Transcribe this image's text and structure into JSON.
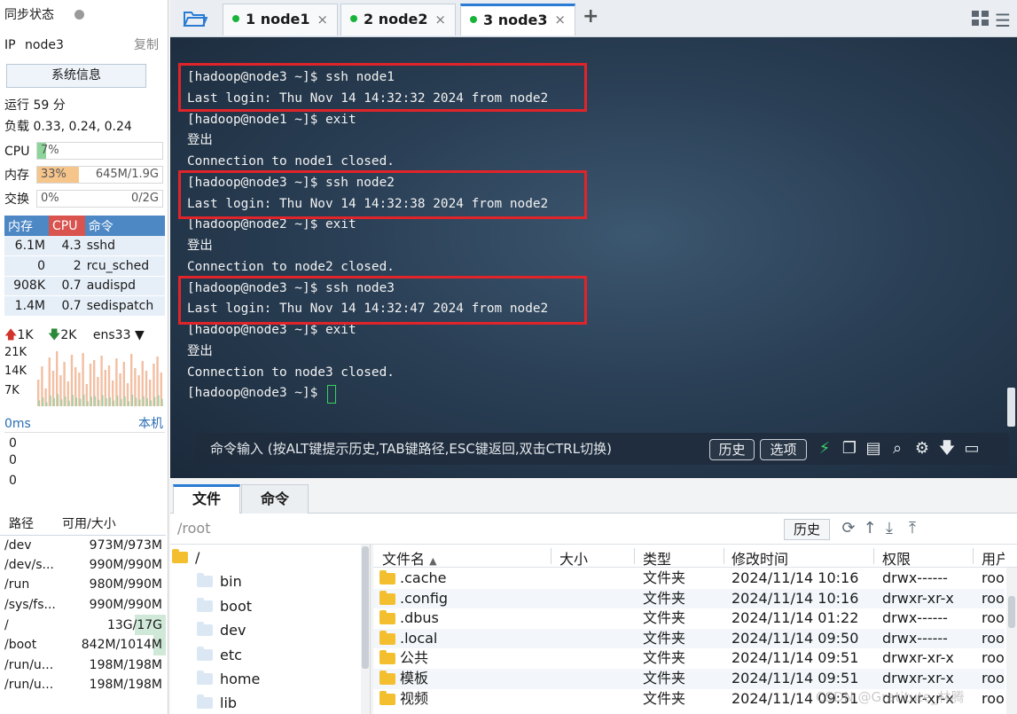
{
  "sidebar": {
    "sync_label": "同步状态",
    "ip_label": "IP",
    "ip_value": "node3",
    "copy_label": "复制",
    "sysinfo_button": "系统信息",
    "uptime": "运行 59 分",
    "load": "负载 0.33, 0.24, 0.24",
    "cpu": {
      "label": "CPU",
      "percent_text": "7%",
      "fraction": 0.07,
      "color": "#8dd49b"
    },
    "mem": {
      "label": "内存",
      "percent_text": "33%",
      "usage": "645M/1.9G",
      "fraction": 0.33,
      "color": "#f5c58c"
    },
    "swap": {
      "label": "交换",
      "percent_text": "0%",
      "usage": "0/2G",
      "fraction": 0.0
    },
    "proc_headers": [
      "内存",
      "CPU",
      "命令"
    ],
    "processes": [
      {
        "mem": "6.1M",
        "cpu": "4.3",
        "cmd": "sshd"
      },
      {
        "mem": "0",
        "cpu": "2",
        "cmd": "rcu_sched"
      },
      {
        "mem": "908K",
        "cpu": "0.7",
        "cmd": "audispd"
      },
      {
        "mem": "1.4M",
        "cpu": "0.7",
        "cmd": "sedispatch"
      }
    ],
    "net": {
      "up": "1K",
      "down": "2K",
      "iface": "ens33",
      "ticks": [
        "21K",
        "14K",
        "7K"
      ]
    },
    "latency": {
      "label": "0ms",
      "host": "本机",
      "values": [
        "0",
        "0",
        "0"
      ]
    },
    "disk_headers": [
      "路径",
      "可用/大小"
    ],
    "disks": [
      {
        "path": "/dev",
        "size": "973M/973M"
      },
      {
        "path": "/dev/s...",
        "size": "990M/990M"
      },
      {
        "path": "/run",
        "size": "980M/990M"
      },
      {
        "path": "/sys/fs...",
        "size": "990M/990M"
      },
      {
        "path": "/",
        "size": "13G/17G"
      },
      {
        "path": "/boot",
        "size": "842M/1014M"
      },
      {
        "path": "/run/u...",
        "size": "198M/198M"
      },
      {
        "path": "/run/u...",
        "size": "198M/198M"
      }
    ]
  },
  "tabs": [
    {
      "label": "1  node1",
      "close": "×"
    },
    {
      "label": "2  node2",
      "close": "×"
    },
    {
      "label": "3  node3",
      "close": "×"
    }
  ],
  "add_tab": "+",
  "terminal": {
    "lines": [
      "[hadoop@node3 ~]$ ssh node1",
      "Last login: Thu Nov 14 14:32:32 2024 from node2",
      "[hadoop@node1 ~]$ exit",
      "登出",
      "Connection to node1 closed.",
      "[hadoop@node3 ~]$ ssh node2",
      "Last login: Thu Nov 14 14:32:38 2024 from node2",
      "[hadoop@node2 ~]$ exit",
      "登出",
      "Connection to node2 closed.",
      "[hadoop@node3 ~]$ ssh node3",
      "Last login: Thu Nov 14 14:32:47 2024 from node2",
      "[hadoop@node3 ~]$ exit",
      "登出",
      "Connection to node3 closed.",
      "[hadoop@node3 ~]$ "
    ],
    "highlight_color": "#e0242a"
  },
  "cmdbar": {
    "hint": "命令输入 (按ALT键提示历史,TAB键路径,ESC键返回,双击CTRL切换)",
    "history_button": "历史",
    "options_button": "选项"
  },
  "files": {
    "tabs": [
      "文件",
      "命令"
    ],
    "path": "/root",
    "history_button": "历史",
    "tree_root": "/",
    "tree": [
      "bin",
      "boot",
      "dev",
      "etc",
      "home",
      "lib"
    ],
    "columns": [
      "文件名",
      "大小",
      "类型",
      "修改时间",
      "权限",
      "用户"
    ],
    "rows": [
      {
        "name": ".cache",
        "size": "",
        "type": "文件夹",
        "mtime": "2024/11/14 10:16",
        "perm": "drwx------",
        "user": "roo"
      },
      {
        "name": ".config",
        "size": "",
        "type": "文件夹",
        "mtime": "2024/11/14 10:16",
        "perm": "drwxr-xr-x",
        "user": "roo"
      },
      {
        "name": ".dbus",
        "size": "",
        "type": "文件夹",
        "mtime": "2024/11/14 01:22",
        "perm": "drwx------",
        "user": "roo"
      },
      {
        "name": ".local",
        "size": "",
        "type": "文件夹",
        "mtime": "2024/11/14 09:50",
        "perm": "drwx------",
        "user": "roo"
      },
      {
        "name": "公共",
        "size": "",
        "type": "文件夹",
        "mtime": "2024/11/14 09:51",
        "perm": "drwxr-xr-x",
        "user": "roo"
      },
      {
        "name": "模板",
        "size": "",
        "type": "文件夹",
        "mtime": "2024/11/14 09:51",
        "perm": "drwxr-xr-x",
        "user": "roo"
      },
      {
        "name": "视频",
        "size": "",
        "type": "文件夹",
        "mtime": "2024/11/14 09:51",
        "perm": "drwxr-xr-x",
        "user": "roo"
      }
    ]
  },
  "watermark": "CSDN @Gratitute_林腾"
}
